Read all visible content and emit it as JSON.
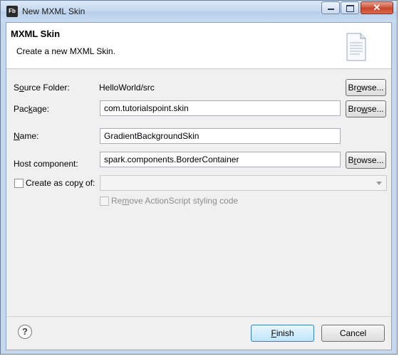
{
  "window": {
    "icon_text": "Fb",
    "title": "New MXML Skin",
    "close_glyph": "✕"
  },
  "banner": {
    "title": "MXML Skin",
    "description": "Create a new MXML Skin."
  },
  "form": {
    "source_folder": {
      "label_pre": "S",
      "label_u": "o",
      "label_post": "urce Folder:",
      "value": "HelloWorld/src",
      "browse_pre": "Br",
      "browse_u": "o",
      "browse_post": "wse..."
    },
    "package": {
      "label_pre": "Pac",
      "label_u": "k",
      "label_post": "age:",
      "value": "com.tutorialspoint.skin",
      "browse_pre": "Bro",
      "browse_u": "w",
      "browse_post": "se..."
    },
    "name": {
      "label_pre": "",
      "label_u": "N",
      "label_post": "ame:",
      "value": "GradientBackgroundSkin"
    },
    "host_component": {
      "label": "Host component:",
      "value": "spark.components.BorderContainer",
      "browse_pre": "B",
      "browse_u": "r",
      "browse_post": "owse..."
    },
    "copy_of": {
      "label_pre": "Create as cop",
      "label_u": "y",
      "label_post": " of:",
      "checked": false,
      "value": ""
    },
    "remove_styling": {
      "label_pre": "Re",
      "label_u": "m",
      "label_post": "ove ActionScript styling code",
      "checked": false,
      "enabled": false
    }
  },
  "footer": {
    "help_glyph": "?",
    "finish_pre": "",
    "finish_u": "F",
    "finish_post": "inish",
    "cancel_label": "Cancel"
  }
}
